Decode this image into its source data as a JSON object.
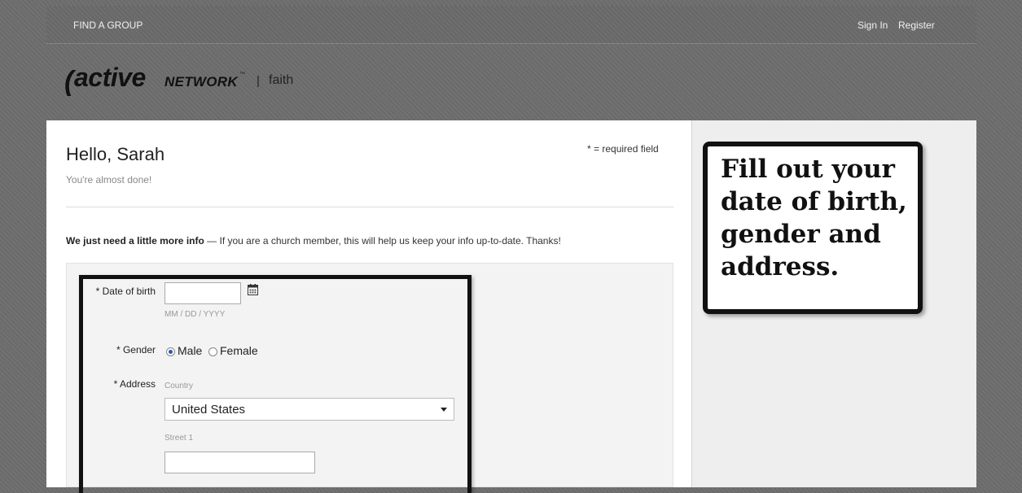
{
  "nav": {
    "find_group": "FIND A GROUP",
    "sign_in": "Sign In",
    "register": "Register"
  },
  "logo": {
    "paren": "(",
    "active": "active",
    "network": "NETWORK",
    "tm": "™",
    "separator": "|",
    "faith": "faith"
  },
  "header": {
    "greeting": "Hello, Sarah",
    "subtitle": "You're almost done!",
    "required_note": "* = required field"
  },
  "info": {
    "bold": "We just need a little more info",
    "rest": " — If you are a church member, this will help us keep your info up-to-date. Thanks!"
  },
  "form": {
    "dob_label": "* Date of birth",
    "dob_value": "",
    "dob_hint": "MM / DD / YYYY",
    "gender_label": "* Gender",
    "gender_male": "Male",
    "gender_female": "Female",
    "gender_selected": "Male",
    "address_label": "* Address",
    "country_hint": "Country",
    "country_value": "United States",
    "street1_hint": "Street 1",
    "street1_value": ""
  },
  "callout": {
    "text": "Fill out your date of birth, gender and address."
  },
  "icons": {
    "calendar": "calendar-icon",
    "dropdown": "chevron-down-icon"
  },
  "colors": {
    "background": "#6d6d6d",
    "panel": "#ffffff",
    "sidebar": "#eeeeee",
    "form_box": "#f3f3f3",
    "radio_selected": "#2a5aa8"
  }
}
